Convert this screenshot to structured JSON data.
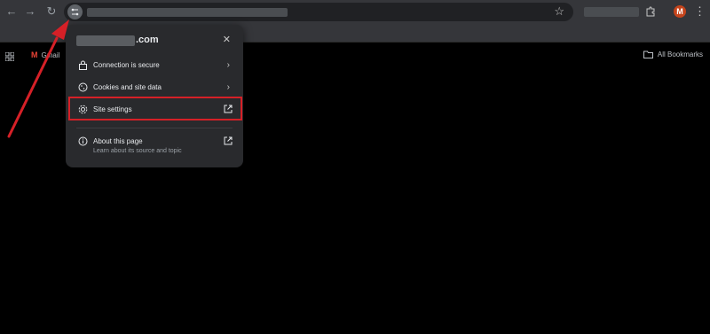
{
  "toolbar": {
    "back_icon": "arrow-left-icon",
    "forward_icon": "arrow-right-icon",
    "reload_icon": "reload-icon",
    "bookmark_icon": "star-icon",
    "menu_icon": "more-vertical-icon",
    "avatar_letter": "M"
  },
  "bookmarks": {
    "gmail_label": "Gmail",
    "all_label": "All Bookmarks"
  },
  "popup": {
    "domain_suffix": ".com",
    "items": [
      {
        "label": "Connection is secure",
        "icon": "lock-icon"
      },
      {
        "label": "Cookies and site data",
        "icon": "cookie-icon"
      },
      {
        "label": "Site settings",
        "icon": "gear-icon"
      },
      {
        "label": "About this page",
        "sub": "Learn about its source and topic",
        "icon": "info-icon"
      }
    ]
  },
  "colors": {
    "highlight": "#d62027",
    "avatar": "#c4441c"
  }
}
